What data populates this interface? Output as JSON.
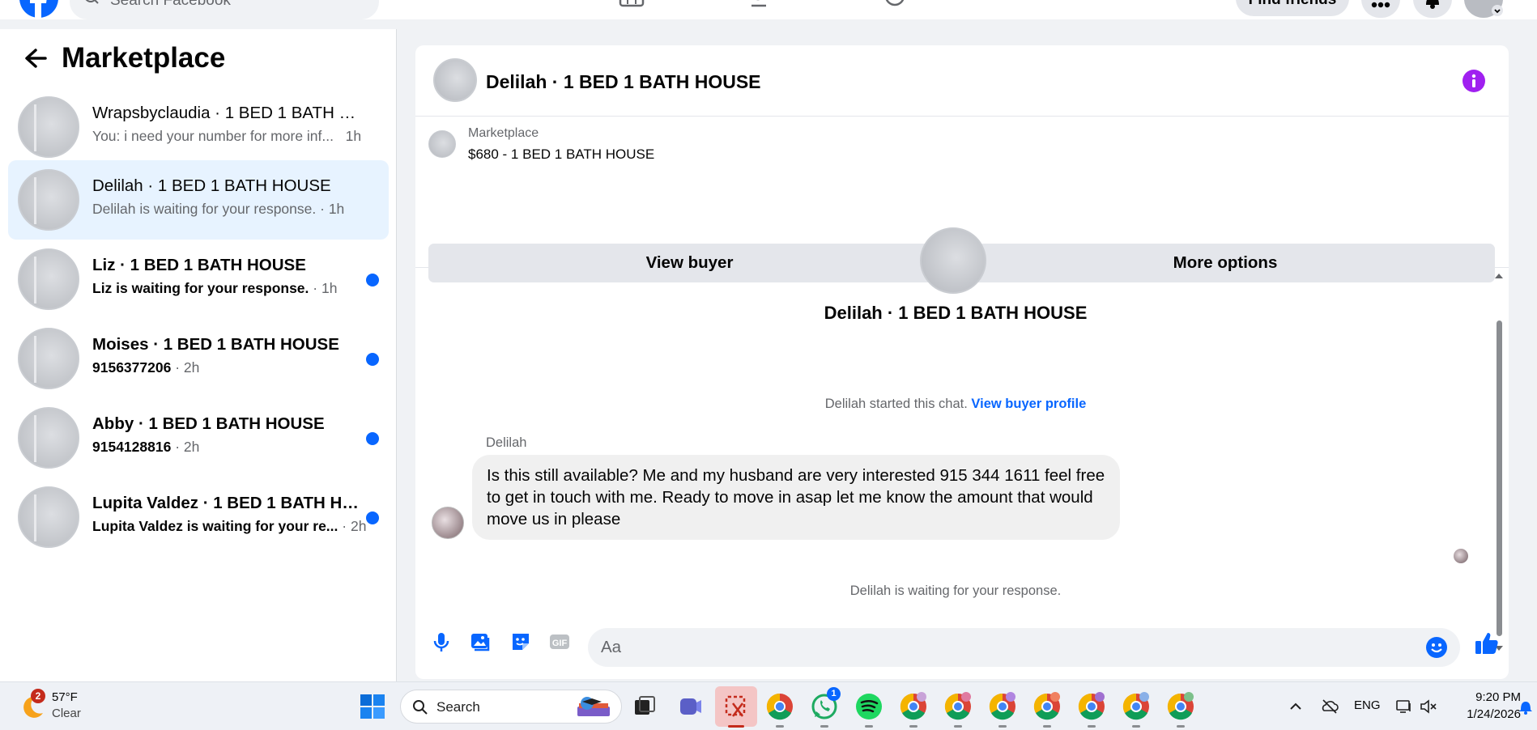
{
  "colors": {
    "accent": "#0866ff",
    "active_row": "#e7f3ff",
    "info": "#a020f0",
    "unread_dot": "#0866ff",
    "taskbar": "#eef1f6"
  },
  "topbar": {
    "search_placeholder": "Search Facebook",
    "find_friends_label": "Find friends",
    "icons": [
      "facebook-logo-icon",
      "search-icon",
      "marketplace-icon",
      "groups-icon",
      "gaming-icon",
      "menu-grid-icon",
      "notifications-icon",
      "account-icon"
    ]
  },
  "sidebar": {
    "title": "Marketplace",
    "conversations": [
      {
        "name": "Wrapsbyclaudia · 1 BED 1 BATH H...",
        "preview": "You: i need your number for more inf...",
        "time": "1h",
        "unread": false,
        "active": false
      },
      {
        "name": "Delilah · 1 BED 1 BATH HOUSE",
        "preview": "Delilah is waiting for your response.",
        "time": "· 1h",
        "unread": false,
        "active": true
      },
      {
        "name": "Liz · 1 BED 1 BATH HOUSE",
        "preview": "Liz is waiting for your response.",
        "time": "· 1h",
        "unread": true,
        "active": false
      },
      {
        "name": "Moises · 1 BED 1 BATH HOUSE",
        "preview": "9156377206",
        "time": "· 2h",
        "unread": true,
        "active": false
      },
      {
        "name": "Abby · 1 BED 1 BATH HOUSE",
        "preview": "9154128816",
        "time": "· 2h",
        "unread": true,
        "active": false
      },
      {
        "name": "Lupita Valdez · 1 BED 1 BATH HO...",
        "preview": "Lupita Valdez is waiting for your re...",
        "time": "· 2h",
        "unread": true,
        "active": false
      }
    ]
  },
  "chat": {
    "header_title": "Delilah · 1 BED 1 BATH HOUSE",
    "listing": {
      "kicker": "Marketplace",
      "title": "$680 - 1 BED 1 BATH HOUSE"
    },
    "buttons": {
      "view_buyer": "View buyer",
      "more_options": "More options"
    },
    "intro_name": "Delilah · 1 BED 1 BATH HOUSE",
    "started_text": "Delilah started this chat.",
    "started_link": "View buyer profile",
    "sender": "Delilah",
    "message": "Is this still available? Me and my husband are very interested 915 344 1611 feel free to get in touch with me. Ready to move in asap let me know the amount that would move us in please",
    "waiting_text": "Delilah is waiting for your response.",
    "composer_placeholder": "Aa"
  },
  "taskbar": {
    "weather": {
      "badge": "2",
      "temp": "57°F",
      "condition": "Clear"
    },
    "search_label": "Search",
    "lang": "ENG",
    "time": "9:20 PM",
    "date": "1/24/2026",
    "whatsapp_badge": "1",
    "apps": [
      "start-icon",
      "search",
      "task-view-icon",
      "teams-icon",
      "snipping-tool-icon",
      "chrome-icon",
      "whatsapp-icon",
      "spotify-icon",
      "chrome-profile-icon"
    ]
  }
}
